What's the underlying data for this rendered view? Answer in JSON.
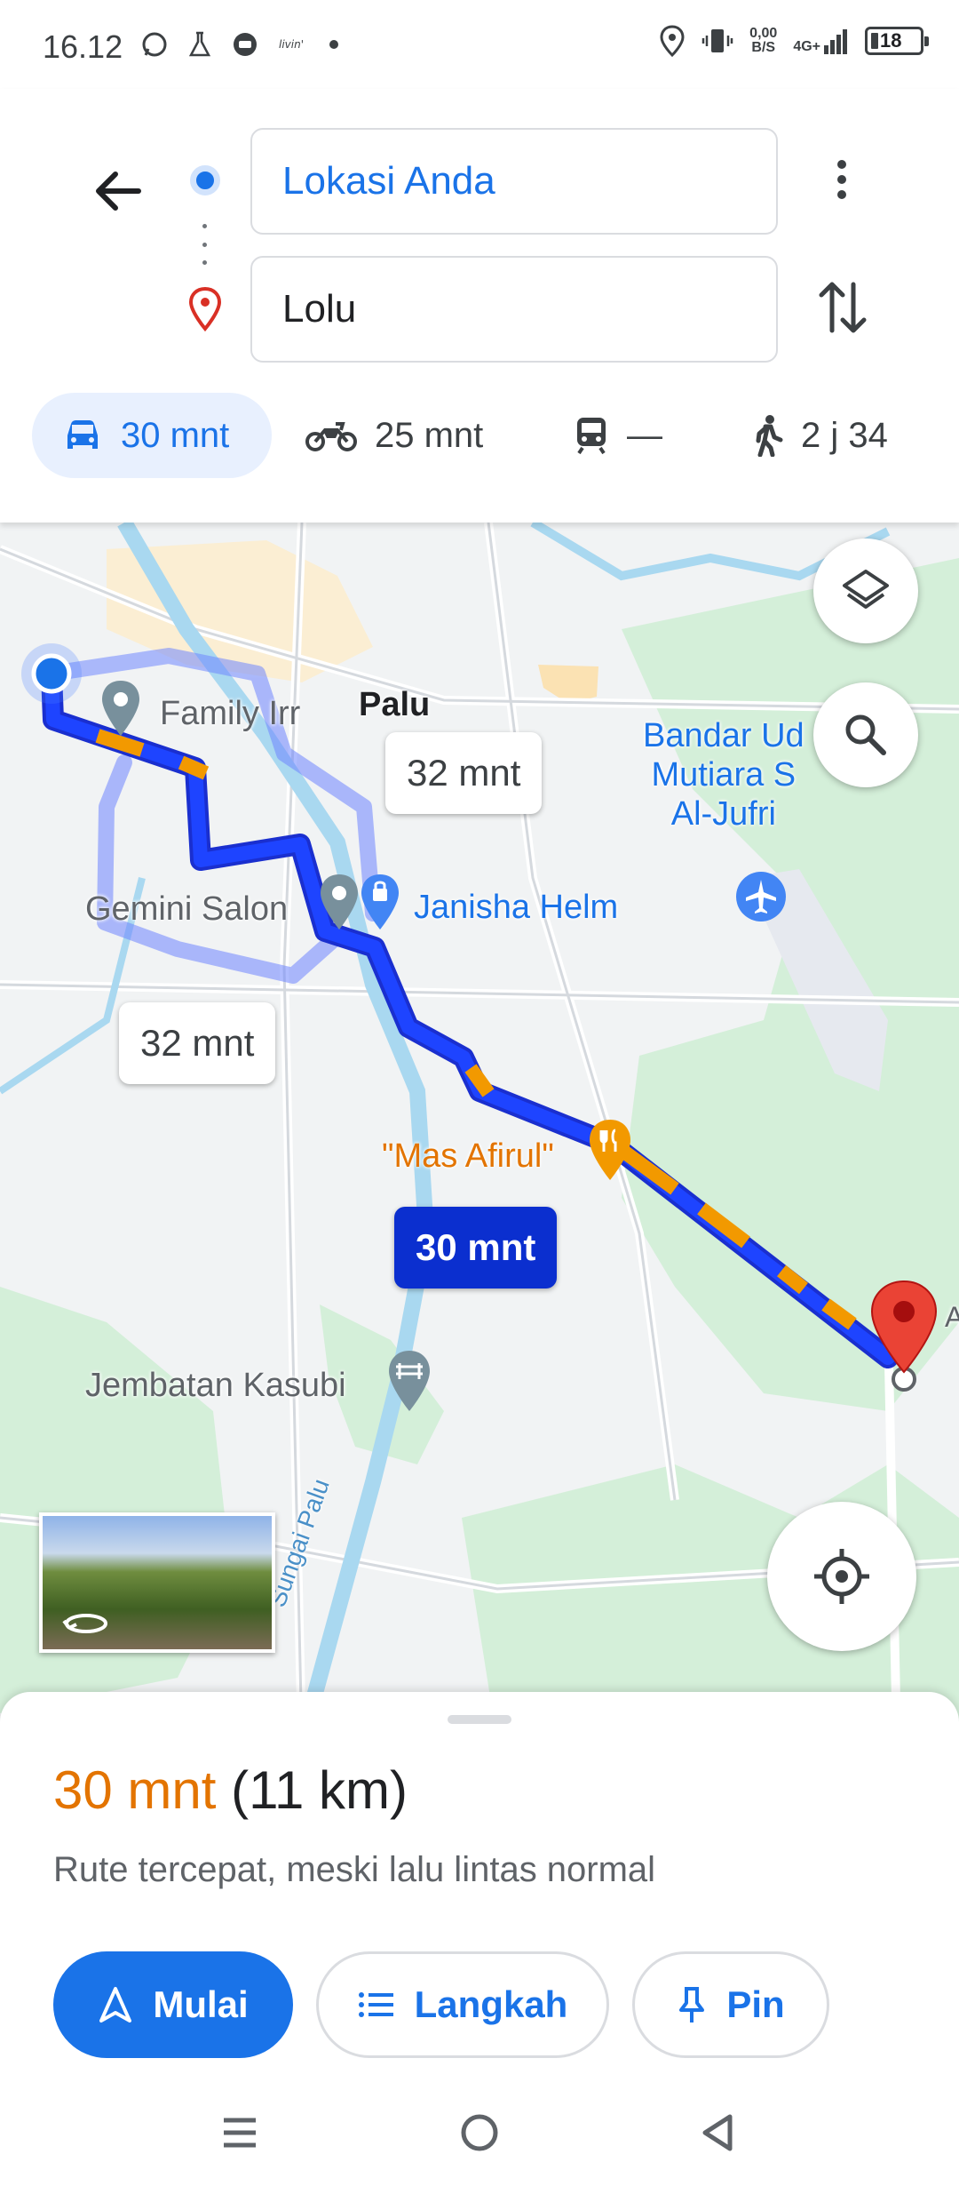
{
  "status_bar": {
    "time": "16.12",
    "net_speed_value": "0,00",
    "net_speed_unit": "B/S",
    "network": "4G+",
    "battery": "18"
  },
  "search": {
    "origin": "Lokasi Anda",
    "destination": "Lolu"
  },
  "modes": [
    {
      "name": "car",
      "label": "30 mnt",
      "selected": true
    },
    {
      "name": "motorcycle",
      "label": "25 mnt"
    },
    {
      "name": "transit",
      "label": "—"
    },
    {
      "name": "walk",
      "label": "2 j 34"
    }
  ],
  "map": {
    "labels": {
      "city": "Palu",
      "family": "Family Irr",
      "gemini": "Gemini Salon",
      "janisha": "Janisha Helm",
      "airport_line1": "Bandar Ud",
      "airport_line2": "Mutiara S",
      "airport_line3": "Al-Jufri",
      "restaurant": "\"Mas Afirul\"",
      "bridge": "Jembatan Kasubi",
      "river": "Sungai Palu",
      "edge": "A"
    },
    "bubbles": {
      "alt1": "32 mnt",
      "alt2": "32 mnt",
      "primary": "30 mnt"
    }
  },
  "sheet": {
    "duration": "30 mnt",
    "distance": "(11 km)",
    "description": "Rute tercepat, meski lalu lintas normal",
    "start_label": "Mulai",
    "steps_label": "Langkah",
    "pin_label": "Pin"
  },
  "colors": {
    "accent": "#1a73e8",
    "route": "#1a3cff",
    "traffic": "#f29900",
    "duration": "#e37400"
  }
}
